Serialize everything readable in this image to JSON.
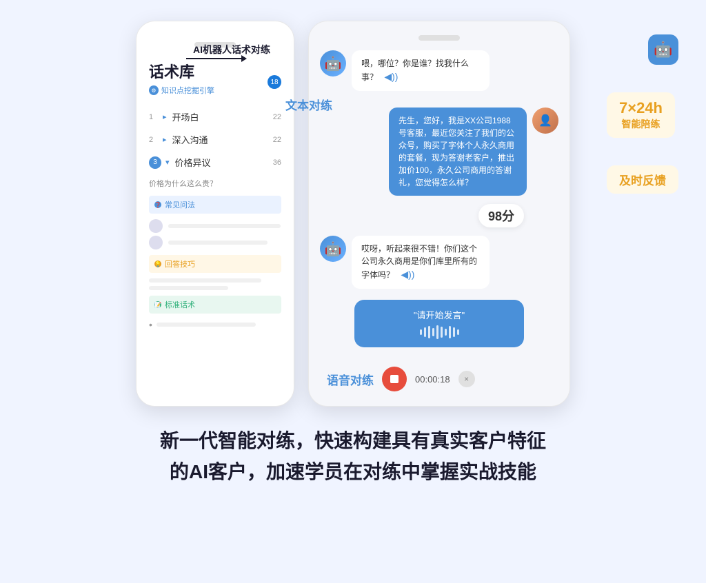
{
  "page": {
    "bg_color": "#f0f4ff"
  },
  "arrow": {
    "label": "AI机器人话术对练"
  },
  "left_phone": {
    "notch": true,
    "title": "话术库",
    "subtitle": "知识点挖掘引擎",
    "badge": "18",
    "menu_items": [
      {
        "num": "1",
        "arrow": "▸",
        "label": "开场白",
        "count": "22",
        "active": false
      },
      {
        "num": "2",
        "arrow": "▸",
        "label": "深入沟通",
        "count": "22",
        "active": false
      },
      {
        "num": "3",
        "arrow": "▾",
        "label": "价格异议",
        "count": "36",
        "active": true
      }
    ],
    "question": "价格为什么这么贵？",
    "sections": [
      {
        "type": "blue",
        "icon": "❓",
        "label": "常见问法",
        "lines": [
          {
            "type": "avatar"
          },
          {
            "type": "avatar"
          }
        ]
      },
      {
        "type": "orange",
        "icon": "💡",
        "label": "回答技巧",
        "lines": [
          "long",
          "short"
        ]
      },
      {
        "type": "green",
        "icon": "📝",
        "label": "标准话术",
        "lines": [
          "bullet"
        ]
      }
    ]
  },
  "right_phone": {
    "notch": true,
    "messages": [
      {
        "type": "bot",
        "text": "喂，哪位？你是谁？找我什么事？",
        "has_sound": true
      },
      {
        "type": "user",
        "text": "先生，您好，我是XX公司1988号客服，最近您关注了我们的公众号，购买了字体个人永久商用的套餐，现为答谢老客户，推出加价100，永久公司商用的答谢礼，您觉得怎么样？"
      },
      {
        "type": "score",
        "value": "98分"
      },
      {
        "type": "bot",
        "text": "哎呀，听起来很不错！你们这个公司永久商用是你们库里所有的字体吗？",
        "has_sound": true
      },
      {
        "type": "voice_input",
        "text": "\"请开始发言\""
      }
    ],
    "voice_controls": {
      "text_label": "语音对练",
      "timer": "00:00:18"
    }
  },
  "badges": {
    "time": {
      "line1": "7×24h",
      "line2": "智能陪练"
    },
    "feedback": "及时反馈"
  },
  "floating_labels": {
    "text_practice": "文本对练",
    "voice_practice": "语音对练"
  },
  "bottom_text": {
    "line1": "新一代智能对练，快速构建具有真实客户特征",
    "line2": "的AI客户，加速学员在对练中掌握实战技能"
  }
}
